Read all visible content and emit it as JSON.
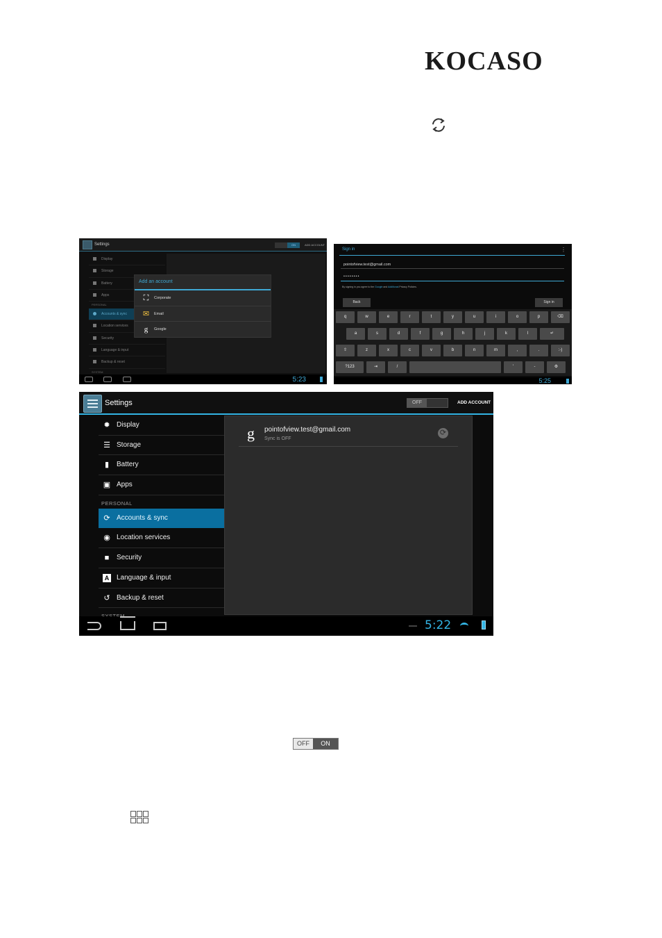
{
  "logo": "KOCASO",
  "screen1": {
    "title": "Settings",
    "switch_label": "ON",
    "add_account": "ADD ACCOUNT",
    "menu": [
      {
        "label": "Display"
      },
      {
        "label": "Storage"
      },
      {
        "label": "Battery"
      },
      {
        "label": "Apps"
      }
    ],
    "section_personal": "PERSONAL",
    "menu_personal": [
      {
        "label": "Accounts & sync",
        "selected": true
      },
      {
        "label": "Location services"
      },
      {
        "label": "Security"
      },
      {
        "label": "Language & input"
      },
      {
        "label": "Backup & reset"
      }
    ],
    "section_system": "SYSTEM",
    "dialog": {
      "title": "Add an account",
      "options": [
        {
          "label": "Corporate",
          "icon": "corporate-icon"
        },
        {
          "label": "Email",
          "icon": "email-icon"
        },
        {
          "label": "Google",
          "icon": "google-icon"
        }
      ]
    },
    "clock": "5:23"
  },
  "screen2": {
    "title": "Sign in",
    "email": "pointofview.test@gmail.com",
    "password": "••••••••",
    "terms_prefix": "By signing in you agree to the",
    "terms_google": "Google",
    "terms_and": "and",
    "terms_additional": "Additional",
    "terms_suffix": "Privacy Policies.",
    "back_label": "Back",
    "signin_label": "Sign in",
    "keyboard": {
      "row1": [
        "q",
        "w",
        "e",
        "r",
        "t",
        "y",
        "u",
        "i",
        "o",
        "p",
        "⌫"
      ],
      "row2": [
        "a",
        "s",
        "d",
        "f",
        "g",
        "h",
        "j",
        "k",
        "l",
        "↵"
      ],
      "row3": [
        "⇧",
        "z",
        "x",
        "c",
        "v",
        "b",
        "n",
        "m",
        ",",
        ".",
        ":-)"
      ],
      "row4": [
        "?123",
        "⇥",
        "/",
        "",
        "'",
        "-",
        "⚙"
      ]
    },
    "clock": "5:25"
  },
  "screen3": {
    "title": "Settings",
    "switch_label": "OFF",
    "add_account": "ADD ACCOUNT",
    "menu": [
      {
        "label": "Display",
        "icon": "display-icon",
        "glyph": "✹"
      },
      {
        "label": "Storage",
        "icon": "storage-icon",
        "glyph": "☰"
      },
      {
        "label": "Battery",
        "icon": "battery-icon",
        "glyph": "▮"
      },
      {
        "label": "Apps",
        "icon": "apps-icon",
        "glyph": "▣"
      }
    ],
    "section_personal": "PERSONAL",
    "menu_personal": [
      {
        "label": "Accounts & sync",
        "icon": "sync-icon",
        "glyph": "⟳",
        "selected": true
      },
      {
        "label": "Location services",
        "icon": "location-icon",
        "glyph": "◉"
      },
      {
        "label": "Security",
        "icon": "lock-icon",
        "glyph": "🔒"
      },
      {
        "label": "Language & input",
        "icon": "language-icon",
        "glyph": "A"
      },
      {
        "label": "Backup & reset",
        "icon": "backup-icon",
        "glyph": "↺"
      }
    ],
    "section_system": "SYSTEM",
    "account": {
      "address": "pointofview.test@gmail.com",
      "status": "Sync is OFF",
      "glyph": "g"
    },
    "clock": "5:22"
  },
  "toggle": {
    "off": "OFF",
    "on": "ON"
  }
}
